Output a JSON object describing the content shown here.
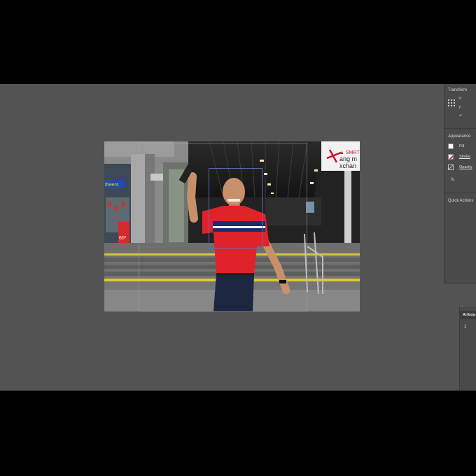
{
  "panels": {
    "properties": {
      "transform_title": "Transform",
      "coords": [
        "X:",
        "Y:",
        "⊿:"
      ],
      "appearance_title": "Appearance",
      "fill_label": "Fill",
      "stroke_label": "Stroke",
      "opacity_label": "Opacity",
      "fx_label": "fx.",
      "quick_actions_title": "Quick Actions"
    },
    "artboards": {
      "tab_label": "Artboa",
      "items": [
        "1"
      ]
    }
  },
  "photo": {
    "sign_text": "ang m\nxchan",
    "store_text": "theers",
    "promo_text": "60*"
  },
  "icons": {
    "transform": "reference-point-grid-icon",
    "fill": "fill-swatch-icon",
    "stroke": "stroke-none-icon",
    "opacity": "opacity-icon",
    "close": "close-icon"
  },
  "colors": {
    "workspace": "#535353",
    "panel": "#4a4a4a",
    "selection": "#5a6db8",
    "shirt_red": "#e0232a"
  }
}
